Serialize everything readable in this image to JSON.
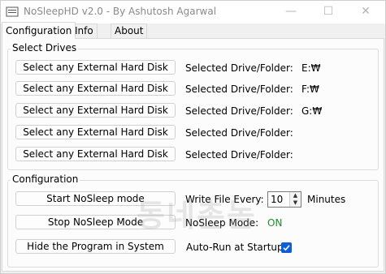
{
  "window": {
    "title": "NoSleepHD v2.0 - By Ashutosh Agarwal",
    "controls": {
      "minimize": "—",
      "maximize": "☐",
      "close": "✕"
    }
  },
  "tabs": [
    "Configuration",
    "Info",
    "About"
  ],
  "select_drives": {
    "group_label": "Select Drives",
    "rows": [
      {
        "button": "Select any External Hard Disk",
        "label": "Selected Drive/Folder:",
        "value": "E:₩"
      },
      {
        "button": "Select any External Hard Disk",
        "label": "Selected Drive/Folder:",
        "value": "F:₩"
      },
      {
        "button": "Select any External Hard Disk",
        "label": "Selected Drive/Folder:",
        "value": "G:₩"
      },
      {
        "button": "Select any External Hard Disk",
        "label": "Selected Drive/Folder:",
        "value": ""
      },
      {
        "button": "Select any External Hard Disk",
        "label": "Selected Drive/Folder:",
        "value": ""
      }
    ]
  },
  "configuration": {
    "group_label": "Configuration",
    "start_button": "Start NoSleep mode",
    "stop_button": "Stop NoSleep Mode",
    "hide_button": "Hide the Program in System",
    "write_file_label": "Write File Every:",
    "write_file_value": "10",
    "minutes_label": "Minutes",
    "mode_label": "NoSleep Mode:",
    "mode_value": "ON",
    "autorun_label": "Auto-Run at Startup",
    "autorun_checked": true
  },
  "watermark": "동네촌놈",
  "colors": {
    "on_status": "#1f8f2a",
    "checkbox": "#0b5ed7"
  }
}
